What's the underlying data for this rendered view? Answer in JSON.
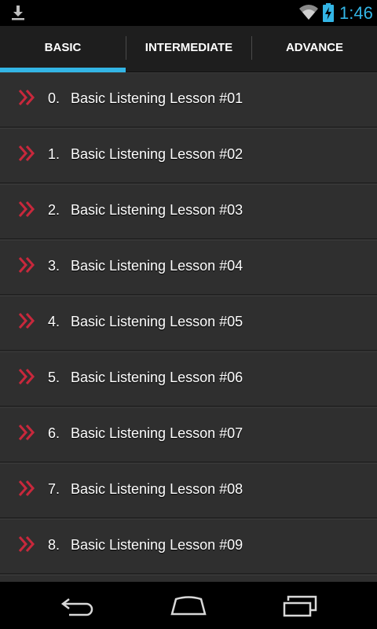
{
  "status_bar": {
    "time": "1:46",
    "icons": [
      "download-icon",
      "wifi-icon",
      "battery-charging-icon"
    ],
    "accent_color": "#33b5e5"
  },
  "tabs": [
    {
      "label": "BASIC",
      "selected": true
    },
    {
      "label": "INTERMEDIATE",
      "selected": false
    },
    {
      "label": "ADVANCE",
      "selected": false
    }
  ],
  "lessons": [
    {
      "number": "0.",
      "title": "Basic Listening Lesson #01"
    },
    {
      "number": "1.",
      "title": "Basic Listening Lesson #02"
    },
    {
      "number": "2.",
      "title": "Basic Listening Lesson #03"
    },
    {
      "number": "3.",
      "title": "Basic Listening Lesson #04"
    },
    {
      "number": "4.",
      "title": "Basic Listening Lesson #05"
    },
    {
      "number": "5.",
      "title": "Basic Listening Lesson #06"
    },
    {
      "number": "6.",
      "title": "Basic Listening Lesson #07"
    },
    {
      "number": "7.",
      "title": "Basic Listening Lesson #08"
    },
    {
      "number": "8.",
      "title": "Basic Listening Lesson #09"
    }
  ],
  "list_item_icon": "double-chevron-right-icon",
  "list_icon_color": "#c8283c",
  "nav_bar": {
    "icons": [
      "back-icon",
      "home-icon",
      "recents-icon"
    ]
  }
}
